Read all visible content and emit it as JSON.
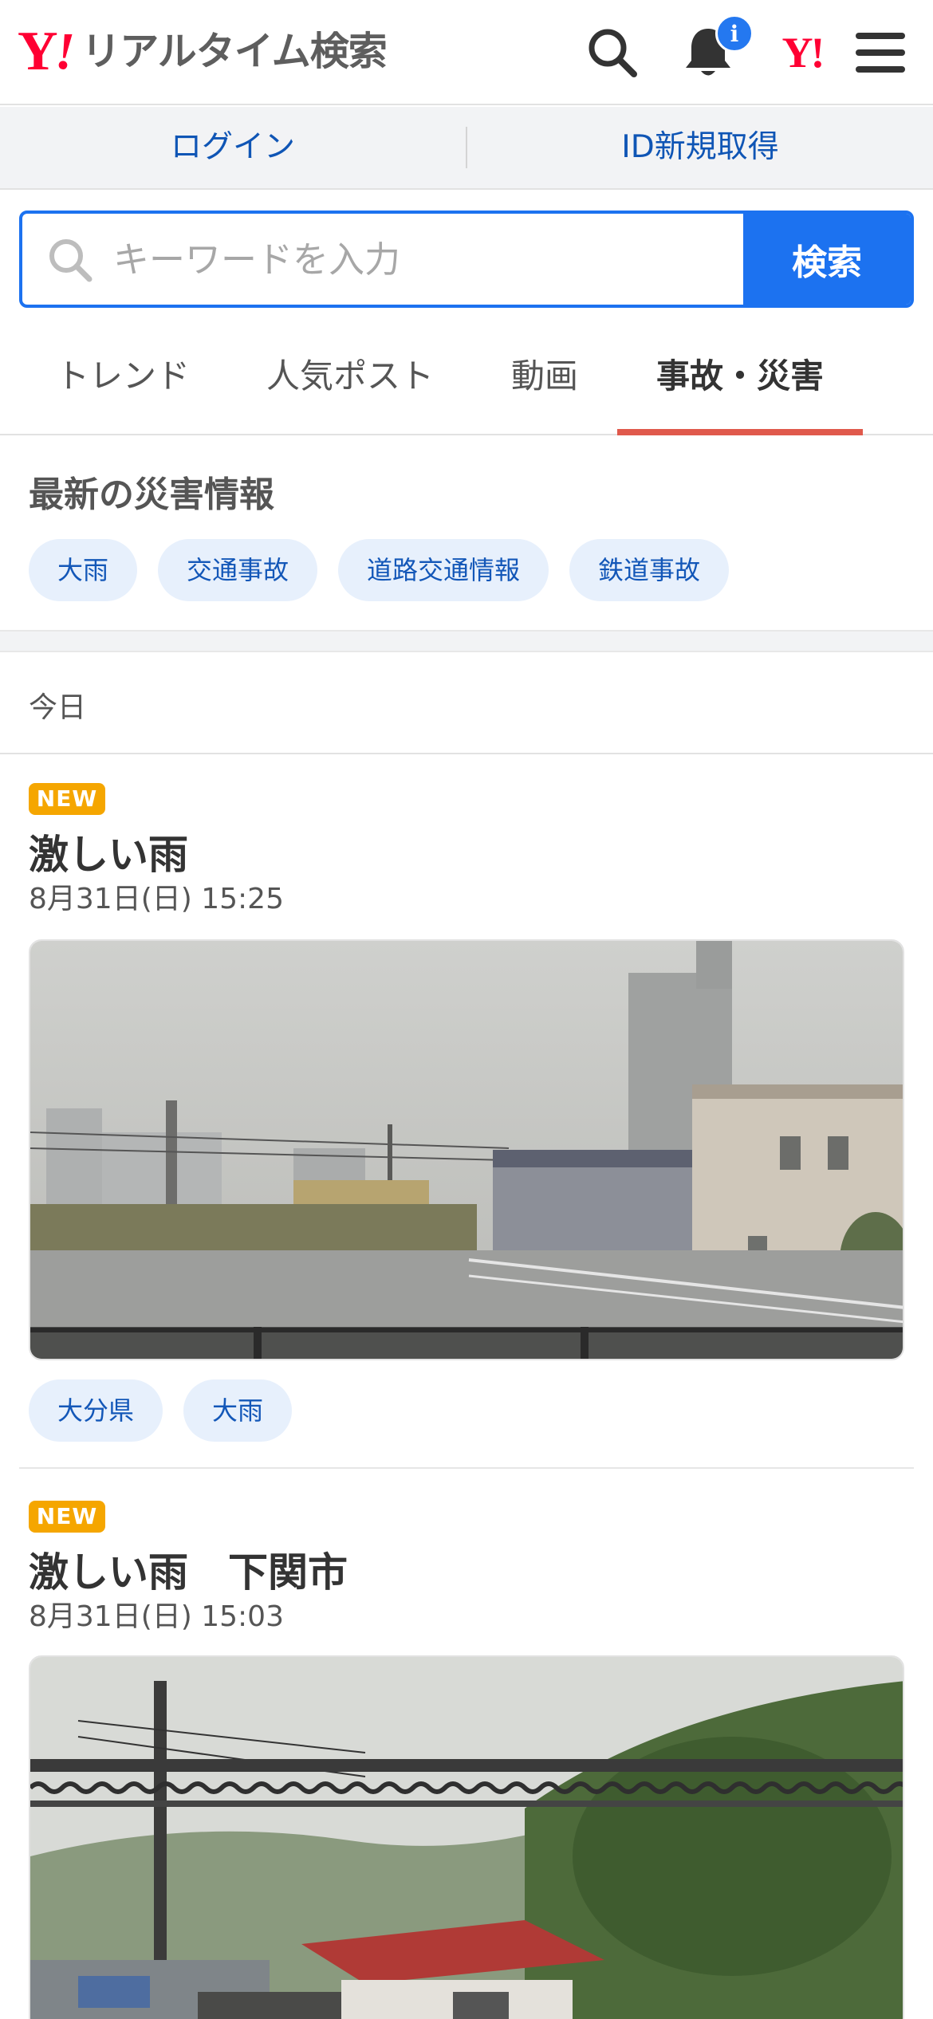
{
  "header": {
    "logo_y": "Y",
    "logo_ex": "!",
    "service_name": "リアルタイム検索",
    "notification_badge": "i",
    "yahoo_mark": "Y!"
  },
  "account": {
    "login_label": "ログイン",
    "register_label": "ID新規取得"
  },
  "search": {
    "placeholder": "キーワードを入力",
    "submit_label": "検索"
  },
  "tabs": [
    {
      "label": "トレンド",
      "active": false
    },
    {
      "label": "人気ポスト",
      "active": false
    },
    {
      "label": "動画",
      "active": false
    },
    {
      "label": "事故・災害",
      "active": true
    }
  ],
  "disaster": {
    "title": "最新の災害情報",
    "tags": [
      "大雨",
      "交通事故",
      "道路交通情報",
      "鉄道事故"
    ]
  },
  "date_group_label": "今日",
  "posts": [
    {
      "badge": "NEW",
      "title": "激しい雨",
      "time": "8月31日(日) 15:25",
      "tags": [
        "大分県",
        "大雨"
      ]
    },
    {
      "badge": "NEW",
      "title": "激しい雨　下関市",
      "time": "8月31日(日) 15:03"
    }
  ],
  "colors": {
    "brand_red": "#ff0033",
    "accent_blue": "#1c72f0",
    "active_tab_underline": "#e0594c",
    "new_badge": "#f5a600",
    "chip_bg": "#e7f0fc"
  }
}
